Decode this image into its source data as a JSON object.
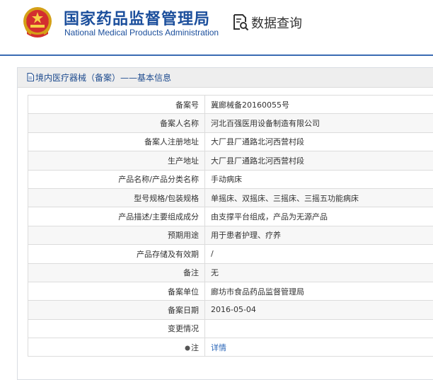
{
  "header": {
    "brand_cn": "国家药品监督管理局",
    "brand_en": "National Medical Products Administration",
    "query_title": "数据查询",
    "accent": "#1c4f9c",
    "emblem_icon": "national-emblem-icon",
    "query_icon": "document-search-icon"
  },
  "panel": {
    "title": "境内医疗器械（备案）——基本信息",
    "rows": [
      {
        "label": "备案号",
        "value": "冀廊械备20160055号"
      },
      {
        "label": "备案人名称",
        "value": "河北百强医用设备制造有限公司"
      },
      {
        "label": "备案人注册地址",
        "value": "大厂县厂通路北河西营村段"
      },
      {
        "label": "生产地址",
        "value": "大厂县厂通路北河西营村段"
      },
      {
        "label": "产品名称/产品分类名称",
        "value": "手动病床"
      },
      {
        "label": "型号规格/包装规格",
        "value": "单摇床、双摇床、三摇床、三摇五功能病床"
      },
      {
        "label": "产品描述/主要组成成分",
        "value": "由支撑平台组成，产品为无源产品"
      },
      {
        "label": "预期用途",
        "value": "用于患者护理、疗养"
      },
      {
        "label": "产品存储及有效期",
        "value": "/"
      },
      {
        "label": "备注",
        "value": "无"
      },
      {
        "label": "备案单位",
        "value": "廊坊市食品药品监督管理局"
      },
      {
        "label": "备案日期",
        "value": "2016-05-04"
      },
      {
        "label": "变更情况",
        "value": ""
      }
    ],
    "note_label": "注",
    "note_link": "详情",
    "link_color": "#2a66b8"
  }
}
